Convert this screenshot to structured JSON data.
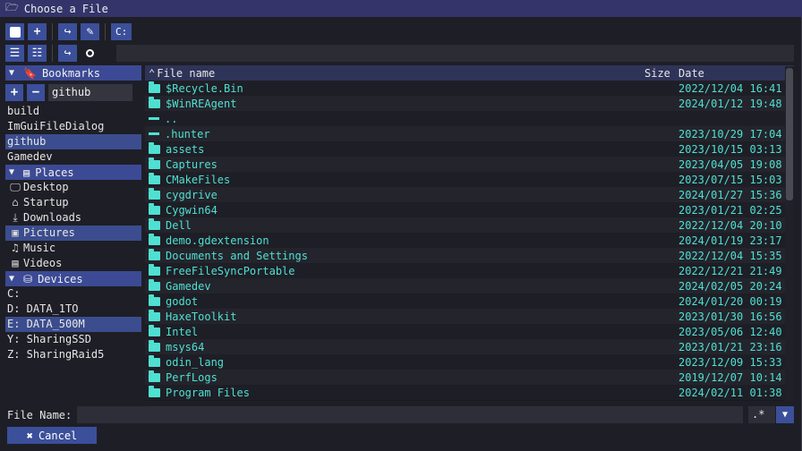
{
  "window": {
    "title": "Choose a File"
  },
  "toolbar": {
    "drive_label": "C:"
  },
  "bookmarks": {
    "header": "Bookmarks",
    "input_value": "github",
    "items": [
      {
        "label": "build",
        "selected": false
      },
      {
        "label": "ImGuiFileDialog",
        "selected": false
      },
      {
        "label": "github",
        "selected": true
      },
      {
        "label": "Gamedev",
        "selected": false
      }
    ]
  },
  "places": {
    "header": "Places",
    "items": [
      {
        "label": "Desktop",
        "icon": "monitor-icon",
        "glyph": "🖵",
        "selected": false
      },
      {
        "label": "Startup",
        "icon": "home-icon",
        "glyph": "⌂",
        "selected": false
      },
      {
        "label": "Downloads",
        "icon": "download-icon",
        "glyph": "⤓",
        "selected": false
      },
      {
        "label": "Pictures",
        "icon": "image-icon",
        "glyph": "▣",
        "selected": true
      },
      {
        "label": "Music",
        "icon": "music-icon",
        "glyph": "♫",
        "selected": false
      },
      {
        "label": "Videos",
        "icon": "film-icon",
        "glyph": "▤",
        "selected": false
      }
    ]
  },
  "devices": {
    "header": "Devices",
    "items": [
      {
        "label": "C:",
        "selected": false
      },
      {
        "label": "D: DATA_1TO",
        "selected": false
      },
      {
        "label": "E: DATA_500M",
        "selected": true
      },
      {
        "label": "Y: SharingSSD",
        "selected": false
      },
      {
        "label": "Z: SharingRaid5",
        "selected": false
      }
    ]
  },
  "table": {
    "columns": {
      "name": "File name",
      "size": "Size",
      "date": "Date"
    },
    "rows": [
      {
        "name": "$Recycle.Bin",
        "date": "2022/12/04 16:41",
        "kind": "folder"
      },
      {
        "name": "$WinREAgent",
        "date": "2024/01/12 19:48",
        "kind": "folder"
      },
      {
        "name": "..",
        "date": "",
        "kind": "link"
      },
      {
        "name": ".hunter",
        "date": "2023/10/29 17:04",
        "kind": "link"
      },
      {
        "name": "assets",
        "date": "2023/10/15 03:13",
        "kind": "folder"
      },
      {
        "name": "Captures",
        "date": "2023/04/05 19:08",
        "kind": "folder"
      },
      {
        "name": "CMakeFiles",
        "date": "2023/07/15 15:03",
        "kind": "folder"
      },
      {
        "name": "cygdrive",
        "date": "2024/01/27 15:36",
        "kind": "folder"
      },
      {
        "name": "Cygwin64",
        "date": "2023/01/21 02:25",
        "kind": "folder"
      },
      {
        "name": "Dell",
        "date": "2022/12/04 20:10",
        "kind": "folder"
      },
      {
        "name": "demo.gdextension",
        "date": "2024/01/19 23:17",
        "kind": "folder"
      },
      {
        "name": "Documents and Settings",
        "date": "2022/12/04 15:35",
        "kind": "folder"
      },
      {
        "name": "FreeFileSyncPortable",
        "date": "2022/12/21 21:49",
        "kind": "folder"
      },
      {
        "name": "Gamedev",
        "date": "2024/02/05 20:24",
        "kind": "folder"
      },
      {
        "name": "godot",
        "date": "2024/01/20 00:19",
        "kind": "folder"
      },
      {
        "name": "HaxeToolkit",
        "date": "2023/01/30 16:56",
        "kind": "folder"
      },
      {
        "name": "Intel",
        "date": "2023/05/06 12:40",
        "kind": "folder"
      },
      {
        "name": "msys64",
        "date": "2023/01/21 23:16",
        "kind": "folder"
      },
      {
        "name": "odin_lang",
        "date": "2023/12/09 15:33",
        "kind": "folder"
      },
      {
        "name": "PerfLogs",
        "date": "2019/12/07 10:14",
        "kind": "folder"
      },
      {
        "name": "Program Files",
        "date": "2024/02/11 01:38",
        "kind": "folder"
      }
    ]
  },
  "footer": {
    "file_name_label": "File Name:",
    "file_name_value": "",
    "filter_value": ".*",
    "cancel_label": "Cancel"
  },
  "colors": {
    "accent": "#3b4f9a",
    "title_bar": "#34346a",
    "file_text": "#4fe0d2",
    "selection": "#3b4d8e"
  }
}
